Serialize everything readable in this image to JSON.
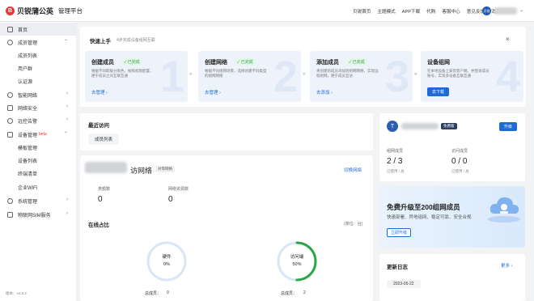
{
  "header": {
    "logo_char": "B",
    "app_name": "贝锐蒲公英",
    "platform_label": "管理平台",
    "nav": [
      "贝锐首页",
      "主题模式",
      "APP下载",
      "代购",
      "客服中心",
      "意见反馈",
      "消息"
    ],
    "user_avatar_text": "贝锐"
  },
  "sidebar": {
    "items": [
      {
        "label": "首页",
        "active": true,
        "arrow": ""
      },
      {
        "label": "成员管理",
        "arrow": "⌃"
      },
      {
        "label": "成员列表",
        "sub": true
      },
      {
        "label": "用户群",
        "sub": true
      },
      {
        "label": "认证源",
        "sub": true
      },
      {
        "label": "智能网络",
        "arrow": "›"
      },
      {
        "label": "网络安全",
        "arrow": "›"
      },
      {
        "label": "远控告警",
        "arrow": "›"
      },
      {
        "label": "设备管理",
        "badge": "beta",
        "arrow": "⌃"
      },
      {
        "label": "模板管理",
        "sub": true
      },
      {
        "label": "设备列表",
        "sub": true
      },
      {
        "label": "终端清单",
        "sub": true
      },
      {
        "label": "企业WiFi",
        "sub": true
      },
      {
        "label": "系统管理",
        "arrow": "›"
      },
      {
        "label": "物联网SIM服务",
        "arrow": "›"
      }
    ],
    "version": "版本：v4.9.2"
  },
  "quickstart": {
    "title": "快速上手",
    "desc": "4步完成设备组网互联",
    "close": "×",
    "steps": [
      {
        "num": "1",
        "title": "创建成员",
        "badge": "✓ 已完成",
        "desc": "根据不同职级分角色，按照权限配置，便于成员之间互联互通",
        "action": "去管理 ›"
      },
      {
        "num": "2",
        "title": "创建网络",
        "badge": "✓ 已完成",
        "desc": "根据不同组网场景，选择创建不同类型的组网网络",
        "action": "去管理 ›"
      },
      {
        "num": "3",
        "title": "添加成员",
        "badge": "✓ 已完成",
        "desc": "将创建的成员添加到组网网络，实现远程组网，便于成员互访",
        "action": "去添加 ›"
      },
      {
        "num": "4",
        "title": "设备组网",
        "badge": "",
        "desc": "在本地设备上安装客户端，并登录成员账号，实现多设备互联互通",
        "action": "去下载"
      }
    ]
  },
  "recent": {
    "title": "最近访问",
    "chip": "成员列表"
  },
  "network": {
    "name_suffix": "访网络",
    "tag": "对等网络",
    "switch": "切换网络",
    "stats": [
      {
        "label": "类额数",
        "value": "0"
      },
      {
        "label": "网络资源数",
        "value": "0"
      }
    ]
  },
  "online": {
    "title": "在线占比",
    "unit": "(单位：台)",
    "rings": [
      {
        "label": "硬件",
        "pct": "0%",
        "fraction": 0,
        "total_label": "总成员：",
        "total": "0"
      },
      {
        "label": "访问端",
        "pct": "50%",
        "fraction": 0.5,
        "total_label": "总成员：",
        "total": "2"
      }
    ]
  },
  "account": {
    "initial": "T",
    "tag": "免费版",
    "upgrade": "升级",
    "stats": [
      {
        "label": "组网成员",
        "value": "2 / 3",
        "sub": "已使用 / 总"
      },
      {
        "label": "访问成员",
        "value": "0 / 0",
        "sub": "已使用 / 总"
      }
    ]
  },
  "promo": {
    "title": "免费升级至200组网成员",
    "sub": "快速部署、异地组网、稳定可靠、安全合规",
    "btn": "立即升级"
  },
  "changelog": {
    "title": "更新日志",
    "more": "更多 ›",
    "date": "2023-05-22"
  },
  "colors": {
    "accent": "#1e6bd6",
    "success": "#2aa845",
    "brand": "#e53935"
  }
}
